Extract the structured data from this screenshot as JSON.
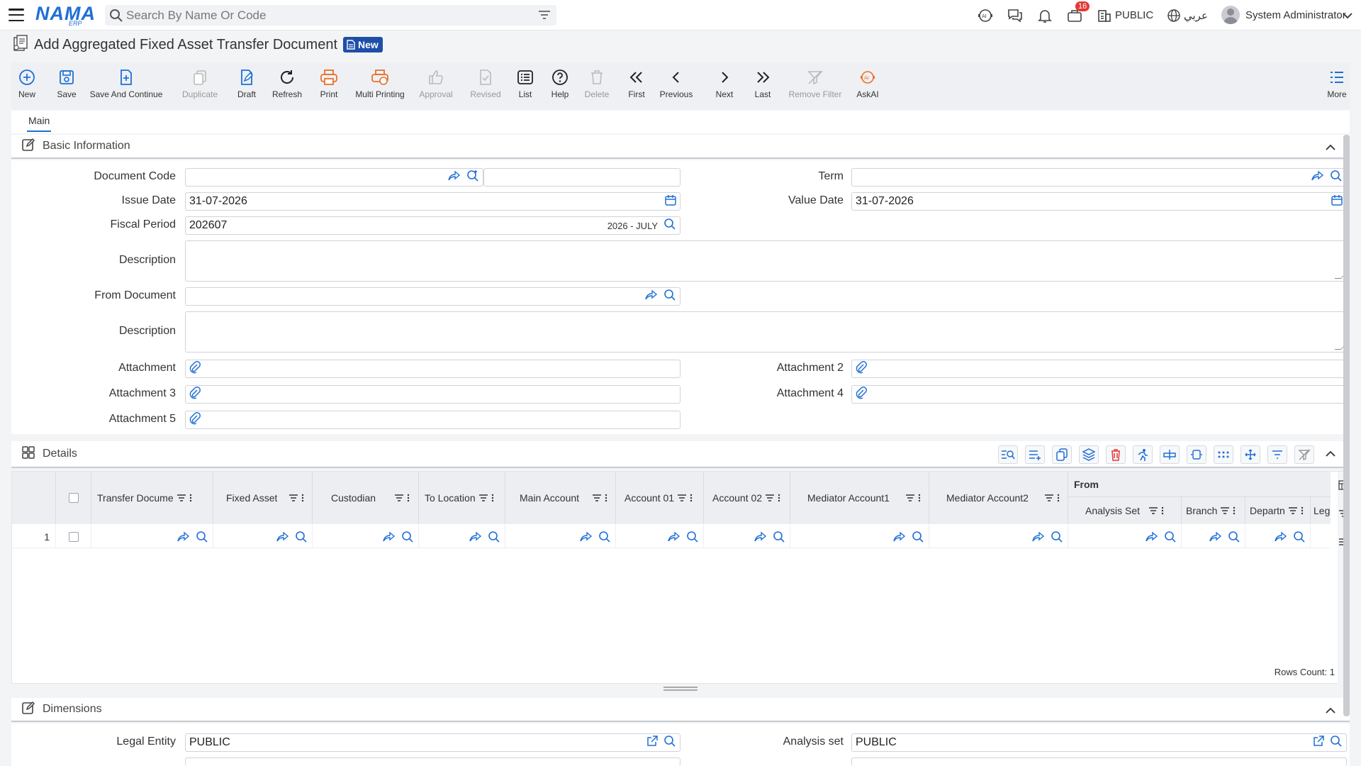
{
  "app": {
    "logo_text": "NAMA",
    "logo_sub": "ERP",
    "search_placeholder": "Search By Name Or Code",
    "notifications_count": "16",
    "company": "PUBLIC",
    "language": "عربي",
    "user": "System Administrator"
  },
  "page": {
    "title": "Add Aggregated Fixed Asset Transfer Document",
    "status_badge": "New"
  },
  "toolbar": {
    "new": "New",
    "save": "Save",
    "save_continue": "Save And Continue",
    "duplicate": "Duplicate",
    "draft": "Draft",
    "refresh": "Refresh",
    "print": "Print",
    "multi_printing": "Multi Printing",
    "approval": "Approval",
    "revised": "Revised",
    "list": "List",
    "help": "Help",
    "delete": "Delete",
    "first": "First",
    "previous": "Previous",
    "next": "Next",
    "last": "Last",
    "remove_filter": "Remove Filter",
    "askai": "AskAI",
    "more": "More"
  },
  "tabs": {
    "main": "Main"
  },
  "basic": {
    "title": "Basic Information",
    "document_code_label": "Document Code",
    "document_code": "",
    "document_code_name": "",
    "term_label": "Term",
    "term": "",
    "issue_date_label": "Issue Date",
    "issue_date": "31-07-2026",
    "value_date_label": "Value Date",
    "value_date": "31-07-2026",
    "fiscal_period_label": "Fiscal Period",
    "fiscal_period": "202607",
    "fiscal_period_hint": "2026 - JULY",
    "description_label": "Description",
    "from_document_label": "From Document",
    "from_document": "",
    "description2_label": "Description",
    "attachment_label": "Attachment",
    "attachment2_label": "Attachment 2",
    "attachment3_label": "Attachment 3",
    "attachment4_label": "Attachment 4",
    "attachment5_label": "Attachment 5"
  },
  "details": {
    "title": "Details",
    "columns": {
      "transfer_document": "Transfer Docume",
      "fixed_asset": "Fixed Asset",
      "custodian": "Custodian",
      "to_location": "To Location",
      "main_account": "Main Account",
      "account01": "Account 01",
      "account02": "Account 02",
      "mediator1": "Mediator Account1",
      "mediator2": "Mediator Account2",
      "from_group": "From",
      "analysis_set": "Analysis Set",
      "branch": "Branch",
      "department": "Departn",
      "legal": "Legal"
    },
    "row_number": "1",
    "rows_count": "Rows Count: 1"
  },
  "dimensions": {
    "title": "Dimensions",
    "legal_entity_label": "Legal Entity",
    "legal_entity": "PUBLIC",
    "analysis_set_label": "Analysis set",
    "analysis_set": "PUBLIC"
  },
  "colors": {
    "accent": "#1f6fd6",
    "badge": "#1e4fa8",
    "danger": "#e53935",
    "orange": "#e8712b"
  }
}
